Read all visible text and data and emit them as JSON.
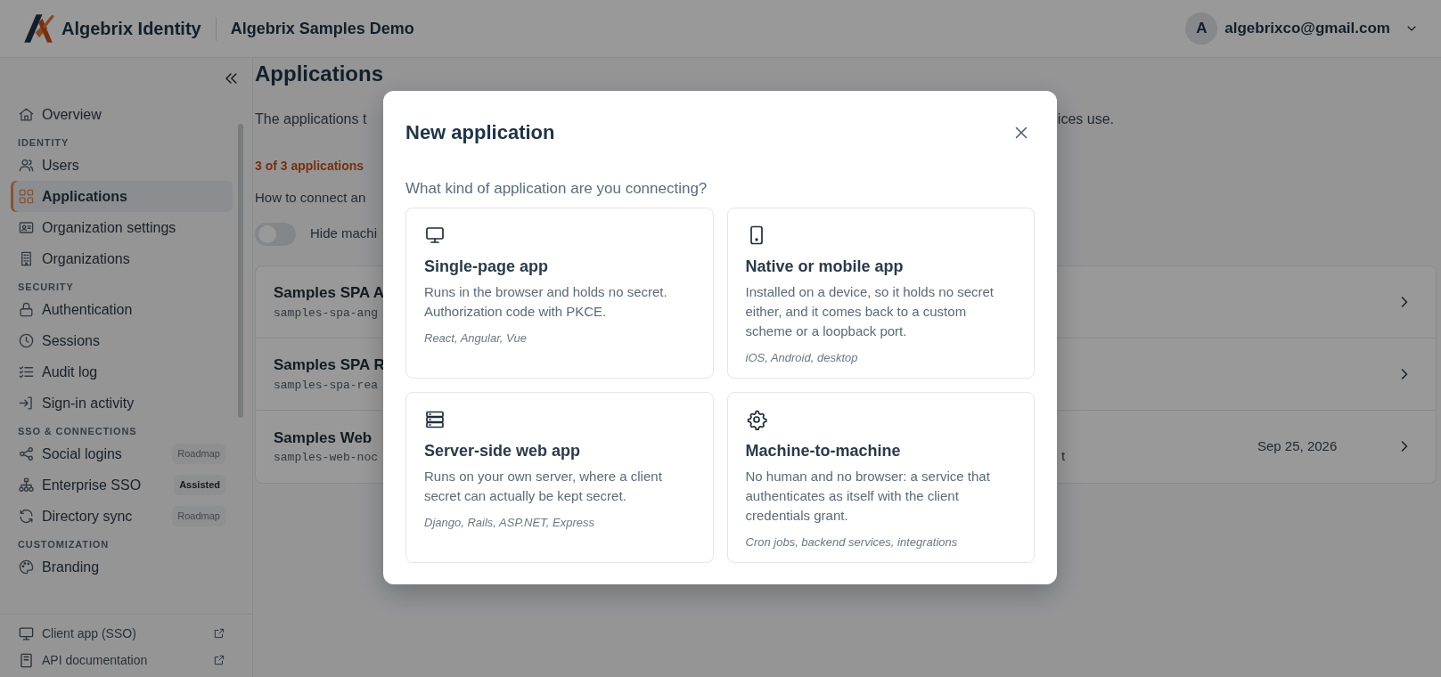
{
  "header": {
    "brand": "Algebrix Identity",
    "project": "Algebrix Samples Demo",
    "user": {
      "initial": "A",
      "email": "algebrixco@gmail.com"
    }
  },
  "sidebar": {
    "sections": [
      {
        "items": [
          {
            "label": "Overview",
            "selected": false
          }
        ]
      },
      {
        "heading": "IDENTITY",
        "items": [
          {
            "label": "Users",
            "selected": false
          },
          {
            "label": "Applications",
            "selected": true
          },
          {
            "label": "Organization settings",
            "selected": false
          },
          {
            "label": "Organizations",
            "selected": false
          }
        ]
      },
      {
        "heading": "SECURITY",
        "items": [
          {
            "label": "Authentication",
            "selected": false
          },
          {
            "label": "Sessions",
            "selected": false
          },
          {
            "label": "Audit log",
            "selected": false
          },
          {
            "label": "Sign-in activity",
            "selected": false
          }
        ]
      },
      {
        "heading": "SSO & CONNECTIONS",
        "items": [
          {
            "label": "Social logins",
            "selected": false,
            "badge": {
              "text": "Roadmap",
              "emphasized": false
            }
          },
          {
            "label": "Enterprise SSO",
            "selected": false,
            "badge": {
              "text": "Assisted",
              "emphasized": true
            }
          },
          {
            "label": "Directory sync",
            "selected": false,
            "badge": {
              "text": "Roadmap",
              "emphasized": false
            }
          }
        ]
      },
      {
        "heading": "CUSTOMIZATION",
        "items": [
          {
            "label": "Branding",
            "selected": false
          }
        ]
      }
    ],
    "footer_links": [
      {
        "label": "Client app (SSO)"
      },
      {
        "label": "API documentation"
      }
    ]
  },
  "page": {
    "title": "Applications",
    "description_left": "The applications t",
    "description_right": "ices use.",
    "count": "3 of 3 applications",
    "help": "How to connect an",
    "toggle": {
      "label": "Hide machi",
      "on": false
    },
    "rows": [
      {
        "name": "Samples SPA A",
        "client_id": "samples-spa-ang"
      },
      {
        "name": "Samples SPA R",
        "client_id": "samples-spa-rea"
      },
      {
        "name": "Samples Web",
        "client_id": "samples-web-noc",
        "column_3": "t",
        "date": "Sep 25, 2026"
      }
    ]
  },
  "modal": {
    "title": "New application",
    "question": "What kind of application are you connecting?",
    "options": [
      {
        "title": "Single-page app",
        "description": "Runs in the browser and holds no secret. Authorization code with PKCE.",
        "examples": "React, Angular, Vue"
      },
      {
        "title": "Native or mobile app",
        "description": "Installed on a device, so it holds no secret either, and it comes back to a custom scheme or a loopback port.",
        "examples": "iOS, Android, desktop"
      },
      {
        "title": "Server-side web app",
        "description": "Runs on your own server, where a client secret can actually be kept secret.",
        "examples": "Django, Rails, ASP.NET, Express"
      },
      {
        "title": "Machine-to-machine",
        "description": "No human and no browser: a service that authenticates as itself with the client credentials grant.",
        "examples": "Cron jobs, backend services, integrations"
      }
    ]
  }
}
